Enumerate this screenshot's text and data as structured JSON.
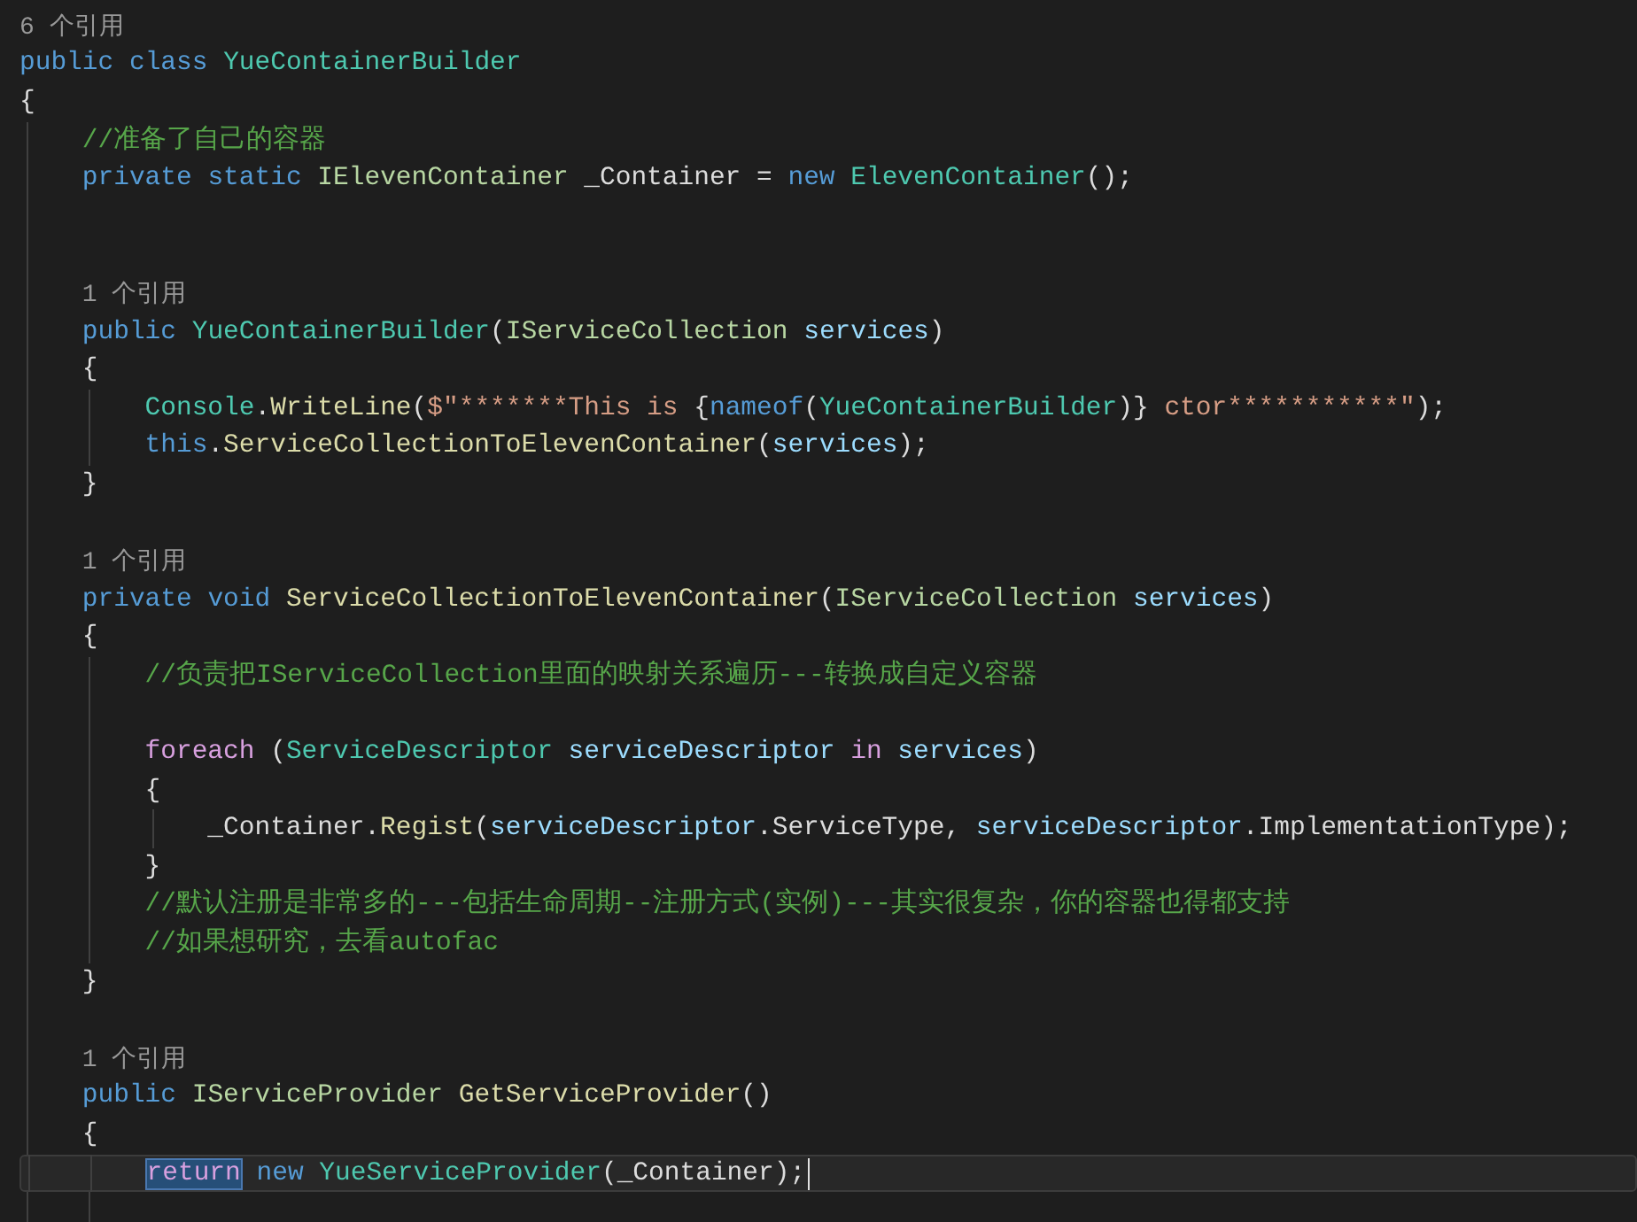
{
  "code": [
    {
      "kind": "codelens",
      "text": "6 个引用"
    },
    {
      "kind": "line",
      "tokens": [
        {
          "t": "public ",
          "kind": "kw"
        },
        {
          "t": "class ",
          "kind": "kw"
        },
        {
          "t": "YueContainerBuilder",
          "kind": "type"
        }
      ]
    },
    {
      "kind": "line",
      "tokens": [
        {
          "t": "{",
          "kind": "plain"
        }
      ]
    },
    {
      "kind": "block",
      "children": [
        {
          "kind": "line",
          "tokens": [
            {
              "t": "//准备了自己的容器",
              "kind": "comment"
            }
          ]
        },
        {
          "kind": "line",
          "tokens": [
            {
              "t": "private static ",
              "kind": "kw"
            },
            {
              "t": "IElevenContainer",
              "kind": "iface"
            },
            {
              "t": " _Container = ",
              "kind": "plain"
            },
            {
              "t": "new ",
              "kind": "kw"
            },
            {
              "t": "ElevenContainer",
              "kind": "type"
            },
            {
              "t": "();",
              "kind": "plain"
            }
          ]
        },
        {
          "kind": "blank"
        },
        {
          "kind": "blank"
        },
        {
          "kind": "codelens",
          "text": "1 个引用"
        },
        {
          "kind": "line",
          "tokens": [
            {
              "t": "public ",
              "kind": "kw"
            },
            {
              "t": "YueContainerBuilder",
              "kind": "type"
            },
            {
              "t": "(",
              "kind": "plain"
            },
            {
              "t": "IServiceCollection ",
              "kind": "iface"
            },
            {
              "t": "services",
              "kind": "param"
            },
            {
              "t": ")",
              "kind": "plain"
            }
          ]
        },
        {
          "kind": "line",
          "tokens": [
            {
              "t": "{",
              "kind": "plain"
            }
          ]
        },
        {
          "kind": "block",
          "children": [
            {
              "kind": "line",
              "tokens": [
                {
                  "t": "Console",
                  "kind": "type"
                },
                {
                  "t": ".",
                  "kind": "plain"
                },
                {
                  "t": "WriteLine",
                  "kind": "method"
                },
                {
                  "t": "(",
                  "kind": "plain"
                },
                {
                  "t": "$\"*******This is ",
                  "kind": "string"
                },
                {
                  "t": "{",
                  "kind": "plain"
                },
                {
                  "t": "nameof",
                  "kind": "kw"
                },
                {
                  "t": "(",
                  "kind": "plain"
                },
                {
                  "t": "YueContainerBuilder",
                  "kind": "type"
                },
                {
                  "t": ")}",
                  "kind": "plain"
                },
                {
                  "t": " ctor***********\"",
                  "kind": "string"
                },
                {
                  "t": ");",
                  "kind": "plain"
                }
              ]
            },
            {
              "kind": "line",
              "tokens": [
                {
                  "t": "this",
                  "kind": "kw"
                },
                {
                  "t": ".",
                  "kind": "plain"
                },
                {
                  "t": "ServiceCollectionToElevenContainer",
                  "kind": "method"
                },
                {
                  "t": "(",
                  "kind": "plain"
                },
                {
                  "t": "services",
                  "kind": "param"
                },
                {
                  "t": ");",
                  "kind": "plain"
                }
              ]
            }
          ]
        },
        {
          "kind": "line",
          "tokens": [
            {
              "t": "}",
              "kind": "plain"
            }
          ]
        },
        {
          "kind": "blank"
        },
        {
          "kind": "codelens",
          "text": "1 个引用"
        },
        {
          "kind": "line",
          "tokens": [
            {
              "t": "private void ",
              "kind": "kw"
            },
            {
              "t": "ServiceCollectionToElevenContainer",
              "kind": "method"
            },
            {
              "t": "(",
              "kind": "plain"
            },
            {
              "t": "IServiceCollection ",
              "kind": "iface"
            },
            {
              "t": "services",
              "kind": "param"
            },
            {
              "t": ")",
              "kind": "plain"
            }
          ]
        },
        {
          "kind": "line",
          "tokens": [
            {
              "t": "{",
              "kind": "plain"
            }
          ]
        },
        {
          "kind": "block",
          "children": [
            {
              "kind": "line",
              "tokens": [
                {
                  "t": "//负责把IServiceCollection里面的映射关系遍历---转换成自定义容器",
                  "kind": "comment"
                }
              ]
            },
            {
              "kind": "blank"
            },
            {
              "kind": "line",
              "tokens": [
                {
                  "t": "foreach",
                  "kind": "ctl"
                },
                {
                  "t": " (",
                  "kind": "plain"
                },
                {
                  "t": "ServiceDescriptor ",
                  "kind": "type"
                },
                {
                  "t": "serviceDescriptor ",
                  "kind": "param"
                },
                {
                  "t": "in ",
                  "kind": "ctl"
                },
                {
                  "t": "services",
                  "kind": "param"
                },
                {
                  "t": ")",
                  "kind": "plain"
                }
              ]
            },
            {
              "kind": "line",
              "tokens": [
                {
                  "t": "{",
                  "kind": "plain"
                }
              ]
            },
            {
              "kind": "block",
              "children": [
                {
                  "kind": "line",
                  "tokens": [
                    {
                      "t": "_Container.",
                      "kind": "plain"
                    },
                    {
                      "t": "Regist",
                      "kind": "method"
                    },
                    {
                      "t": "(",
                      "kind": "plain"
                    },
                    {
                      "t": "serviceDescriptor",
                      "kind": "param"
                    },
                    {
                      "t": ".ServiceType, ",
                      "kind": "plain"
                    },
                    {
                      "t": "serviceDescriptor",
                      "kind": "param"
                    },
                    {
                      "t": ".ImplementationType);",
                      "kind": "plain"
                    }
                  ]
                }
              ]
            },
            {
              "kind": "line",
              "tokens": [
                {
                  "t": "}",
                  "kind": "plain"
                }
              ]
            },
            {
              "kind": "line",
              "tokens": [
                {
                  "t": "//默认注册是非常多的---包括生命周期--注册方式(实例)---其实很复杂，你的容器也得都支持",
                  "kind": "comment"
                }
              ]
            },
            {
              "kind": "line",
              "tokens": [
                {
                  "t": "//如果想研究，去看autofac",
                  "kind": "comment"
                }
              ]
            }
          ]
        },
        {
          "kind": "line",
          "tokens": [
            {
              "t": "}",
              "kind": "plain"
            }
          ]
        },
        {
          "kind": "blank"
        },
        {
          "kind": "codelens",
          "text": "1 个引用"
        },
        {
          "kind": "line",
          "tokens": [
            {
              "t": "public ",
              "kind": "kw"
            },
            {
              "t": "IServiceProvider ",
              "kind": "iface"
            },
            {
              "t": "GetServiceProvider",
              "kind": "method"
            },
            {
              "t": "()",
              "kind": "plain"
            }
          ]
        },
        {
          "kind": "line",
          "tokens": [
            {
              "t": "{",
              "kind": "plain"
            }
          ]
        },
        {
          "kind": "block",
          "children": [
            {
              "kind": "current-line",
              "tokens": [
                {
                  "t": "return",
                  "kind": "sel"
                },
                {
                  "t": " new ",
                  "kind": "kw"
                },
                {
                  "t": "YueServiceProvider",
                  "kind": "type"
                },
                {
                  "t": "(_Container);",
                  "kind": "plain"
                }
              ]
            },
            {
              "kind": "blank"
            }
          ]
        }
      ]
    }
  ]
}
